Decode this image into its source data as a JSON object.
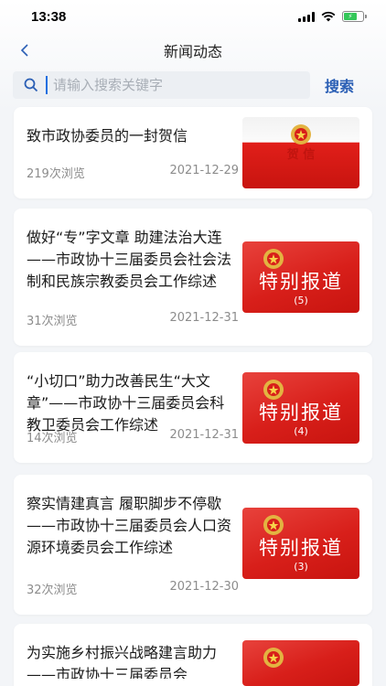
{
  "status_bar": {
    "time": "13:38"
  },
  "nav": {
    "title": "新闻动态"
  },
  "search": {
    "placeholder": "请输入搜索关键字",
    "button_label": "搜索"
  },
  "articles": [
    {
      "title": "致市政协委员的一封贺信",
      "views": "219次浏览",
      "date": "2021-12-29",
      "thumb_label": "贺 信"
    },
    {
      "title": "做好“专”字文章 助建法治大连——市政协十三届委员会社会法制和民族宗教委员会工作综述",
      "views": "31次浏览",
      "date": "2021-12-31",
      "thumb_label": "特别报道",
      "thumb_num": "(5)"
    },
    {
      "title": "“小切口”助力改善民生“大文章”——市政协十三届委员会科教卫委员会工作综述",
      "views": "14次浏览",
      "date": "2021-12-31",
      "thumb_label": "特别报道",
      "thumb_num": "(4)"
    },
    {
      "title": "察实情建真言 履职脚步不停歇——市政协十三届委员会人口资源环境委员会工作综述",
      "views": "32次浏览",
      "date": "2021-12-30",
      "thumb_label": "特别报道",
      "thumb_num": "(3)"
    },
    {
      "title": "为实施乡村振兴战略建言助力——市政协十三届委员会"
    }
  ]
}
